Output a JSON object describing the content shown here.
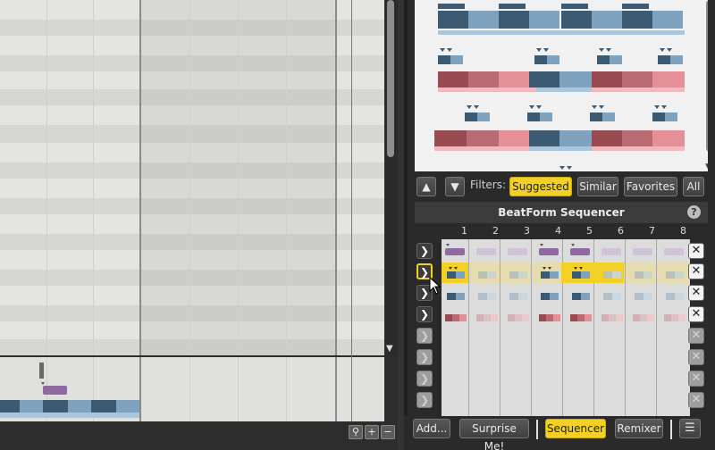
{
  "filters": {
    "label": "Filters:",
    "buttons": [
      {
        "label": "Suggested",
        "active": true
      },
      {
        "label": "Similar",
        "active": false
      },
      {
        "label": "Favorites",
        "active": false
      },
      {
        "label": "All",
        "active": false
      }
    ]
  },
  "sequencer": {
    "title": "BeatForm Sequencer",
    "help": "?",
    "steps": [
      "1",
      "2",
      "3",
      "4",
      "5",
      "6",
      "7",
      "8"
    ]
  },
  "bottom": {
    "add_label": "Add...",
    "surprise_label": "Surprise Me!",
    "sequencer_label": "Sequencer",
    "remixer_label": "Remixer"
  },
  "icons": {
    "play": "chevron-right-icon",
    "close": "close-icon",
    "up": "arrow-up-icon",
    "down": "arrow-down-icon",
    "menu": "menu-icon",
    "zoom": "magnifier-icon",
    "zoom_in": "plus-icon",
    "zoom_out": "minus-icon"
  },
  "colors": {
    "accent": "#f2d026",
    "playhead": "#e05040",
    "blue_dark": "#3c5a72",
    "blue_light": "#7fa3be",
    "red_dark": "#9a4b52",
    "red_light": "#e59096",
    "purple": "#8e6aa0"
  }
}
